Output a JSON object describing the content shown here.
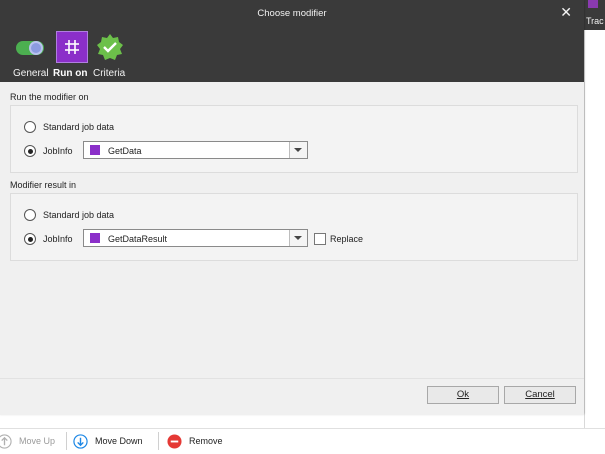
{
  "background": {
    "tray_label": "Trac"
  },
  "dialog": {
    "title": "Choose modifier",
    "tabs": [
      {
        "label": "General",
        "icon": "toggle-switch-icon"
      },
      {
        "label": "Run on",
        "icon": "hash-icon",
        "active": true
      },
      {
        "label": "Criteria",
        "icon": "check-badge-icon"
      }
    ],
    "run_on": {
      "section_label": "Run the modifier on",
      "option_standard": "Standard job data",
      "option_jobinfo": "JobInfo",
      "selected": "JobInfo",
      "jobinfo_value": "GetData"
    },
    "result_in": {
      "section_label": "Modifier result in",
      "option_standard": "Standard job data",
      "option_jobinfo": "JobInfo",
      "selected": "JobInfo",
      "jobinfo_value": "GetDataResult",
      "replace_label": "Replace",
      "replace_checked": false
    },
    "buttons": {
      "ok_label": "Ok",
      "cancel_label": "Cancel"
    }
  },
  "toolbar": {
    "move_up_label": "Move Up",
    "move_down_label": "Move Down",
    "remove_label": "Remove"
  },
  "colors": {
    "accent_purple": "#8b2fc9",
    "dark_header": "#3a3a3a",
    "toggle_green": "#4caf50",
    "check_green": "#6cc04a",
    "move_down_blue": "#1e88e5",
    "remove_red": "#e53935"
  }
}
